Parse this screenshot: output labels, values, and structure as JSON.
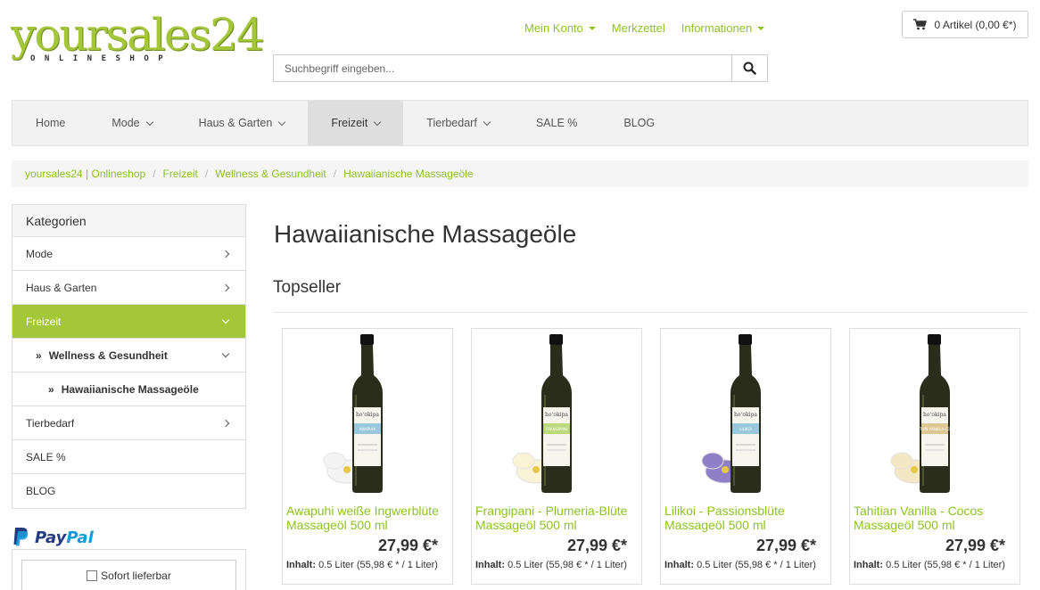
{
  "header": {
    "logo_main": "yoursales24",
    "logo_sub": "ONLINESHOP",
    "top_links": [
      {
        "label": "Mein Konto",
        "dropdown": true
      },
      {
        "label": "Merkzettel",
        "dropdown": false
      },
      {
        "label": "Informationen",
        "dropdown": true
      }
    ],
    "cart_label": "0 Artikel (0,00 €*)",
    "search_placeholder": "Suchbegriff eingeben..."
  },
  "nav": {
    "items": [
      {
        "label": "Home"
      },
      {
        "label": "Mode"
      },
      {
        "label": "Haus & Garten"
      },
      {
        "label": "Freizeit"
      },
      {
        "label": "Tierbedarf"
      },
      {
        "label": "SALE %"
      },
      {
        "label": "BLOG"
      }
    ],
    "active": "Freizeit"
  },
  "breadcrumb": [
    "yoursales24 | Onlineshop",
    "Freizeit",
    "Wellness & Gesundheit",
    "Hawaiianische Massageöle"
  ],
  "sidebar": {
    "title": "Kategorien",
    "items": [
      {
        "label": "Mode"
      },
      {
        "label": "Haus & Garten"
      },
      {
        "label": "Freizeit"
      },
      {
        "label": "Wellness & Gesundheit",
        "marker": "»"
      },
      {
        "label": "Hawaiianische Massageöle",
        "marker": "»"
      },
      {
        "label": "Tierbedarf"
      },
      {
        "label": "SALE %"
      },
      {
        "label": "BLOG"
      }
    ]
  },
  "paypal": {
    "pay": "Pay",
    "pal": "Pal"
  },
  "filter": {
    "label": "Sofort lieferbar"
  },
  "content": {
    "page_title": "Hawaiianische Massageöle",
    "section_title": "Topseller",
    "products": [
      {
        "name": "Awapuhi weiße Ingwerblüte Massageöl 500 ml",
        "price": "27,99 €*",
        "content_label": "Inhalt:",
        "content_value": "0.5 Liter (55,98 € * / 1 Liter)",
        "label_text": "AWAPUHI",
        "brand": "hoʻokipa",
        "flower_color": "#f4f4f4",
        "label_color": "#4aa3c9"
      },
      {
        "name": "Frangipani - Plumeria-Blüte Massageöl 500 ml",
        "price": "27,99 €*",
        "content_label": "Inhalt:",
        "content_value": "0.5 Liter (55,98 € * / 1 Liter)",
        "label_text": "FRANGIPANI",
        "brand": "hoʻokipa",
        "flower_color": "#fbf3d6",
        "label_color": "#8dc21f"
      },
      {
        "name": "Lilikoi - Passionsblüte Massageöl 500 ml",
        "price": "27,99 €*",
        "content_label": "Inhalt:",
        "content_value": "0.5 Liter (55,98 € * / 1 Liter)",
        "label_text": "LILIKOI",
        "brand": "hoʻokipa",
        "flower_color": "#8f7fc7",
        "label_color": "#4aa3c9"
      },
      {
        "name": "Tahitian Vanilla - Cocos Massageöl 500 ml",
        "price": "27,99 €*",
        "content_label": "Inhalt:",
        "content_value": "0.5 Liter (55,98 € * / 1 Liter)",
        "label_text": "TAHITIAN VANILLA-COCOS",
        "brand": "hoʻokipa",
        "flower_color": "#f3e7c4",
        "label_color": "#c9a24a"
      }
    ]
  }
}
